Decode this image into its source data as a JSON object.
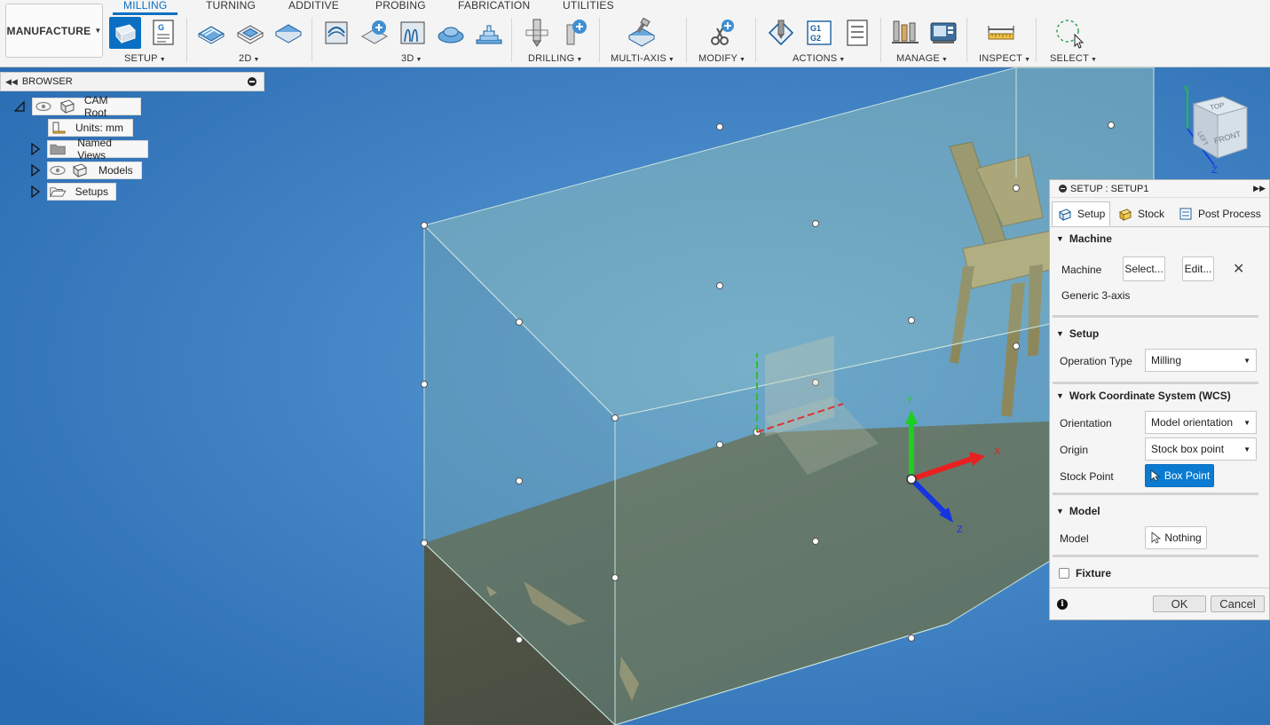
{
  "app": {
    "workspace_label": "MANUFACTURE"
  },
  "tabs": [
    {
      "label": "MILLING",
      "active": true
    },
    {
      "label": "TURNING"
    },
    {
      "label": "ADDITIVE"
    },
    {
      "label": "PROBING"
    },
    {
      "label": "FABRICATION"
    },
    {
      "label": "UTILITIES"
    }
  ],
  "groups": {
    "setup": "SETUP",
    "two_d": "2D",
    "three_d": "3D",
    "drilling": "DRILLING",
    "multi_axis": "MULTI-AXIS",
    "modify": "MODIFY",
    "actions": "ACTIONS",
    "manage": "MANAGE",
    "inspect": "INSPECT",
    "select": "SELECT"
  },
  "icon_text": {
    "nc_program": "G",
    "simulate_g": "G1\nG2"
  },
  "browser": {
    "title": "BROWSER",
    "nodes": {
      "cam_root": "CAM Root",
      "units": "Units: mm",
      "named_views": "Named Views",
      "models": "Models",
      "setups": "Setups"
    }
  },
  "viewcube": {
    "top": "TOP",
    "front": "FRONT",
    "left": "LEFT",
    "axis_y": "Y",
    "axis_z": "Z"
  },
  "triad": {
    "x": "X",
    "y": "Y",
    "z": "Z"
  },
  "panel": {
    "title": "SETUP : SETUP1",
    "tabs": {
      "setup": "Setup",
      "stock": "Stock",
      "post_process": "Post Process"
    },
    "machine": {
      "section": "Machine",
      "label": "Machine",
      "select_button": "Select...",
      "edit_button": "Edit...",
      "name": "Generic 3-axis"
    },
    "setup": {
      "section": "Setup",
      "operation_type_label": "Operation Type",
      "operation_type_value": "Milling"
    },
    "wcs": {
      "section": "Work Coordinate System (WCS)",
      "orientation_label": "Orientation",
      "orientation_value": "Model orientation",
      "origin_label": "Origin",
      "origin_value": "Stock box point",
      "stock_point_label": "Stock Point",
      "stock_point_value": "Box Point"
    },
    "model": {
      "section": "Model",
      "label": "Model",
      "value": "Nothing"
    },
    "fixture": {
      "label": "Fixture",
      "checked": false
    },
    "ok_button": "OK",
    "cancel_button": "Cancel"
  },
  "colors": {
    "accent": "#0a6fc2",
    "viewport_bg": "#3a7fc4",
    "stock_box": "#8fc3b3",
    "floor": "#4d4f40"
  }
}
